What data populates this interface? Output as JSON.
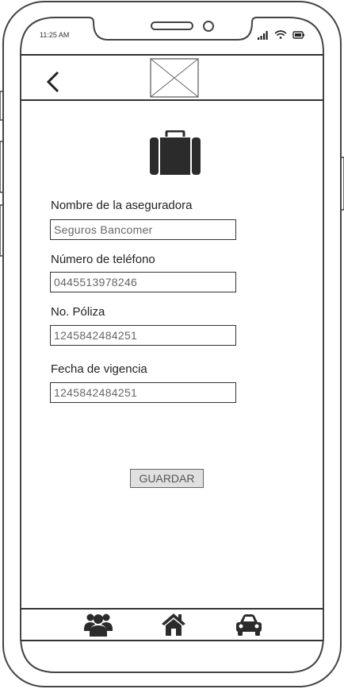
{
  "status_bar": {
    "time": "11:25 AM"
  },
  "header": {
    "back_icon": "chevron-left-icon",
    "logo": "image-placeholder"
  },
  "form": {
    "icon": "briefcase-icon",
    "fields": [
      {
        "label": "Nombre de la aseguradora",
        "value": "Seguros Bancomer"
      },
      {
        "label": "Número de teléfono",
        "value": "0445513978246"
      },
      {
        "label": "No. Póliza",
        "value": "1245842484251"
      },
      {
        "label": "Fecha de vigencia",
        "value": "1245842484251"
      }
    ],
    "save_label": "GUARDAR"
  },
  "bottom_nav": {
    "items": [
      "users-icon",
      "home-icon",
      "car-icon"
    ]
  }
}
